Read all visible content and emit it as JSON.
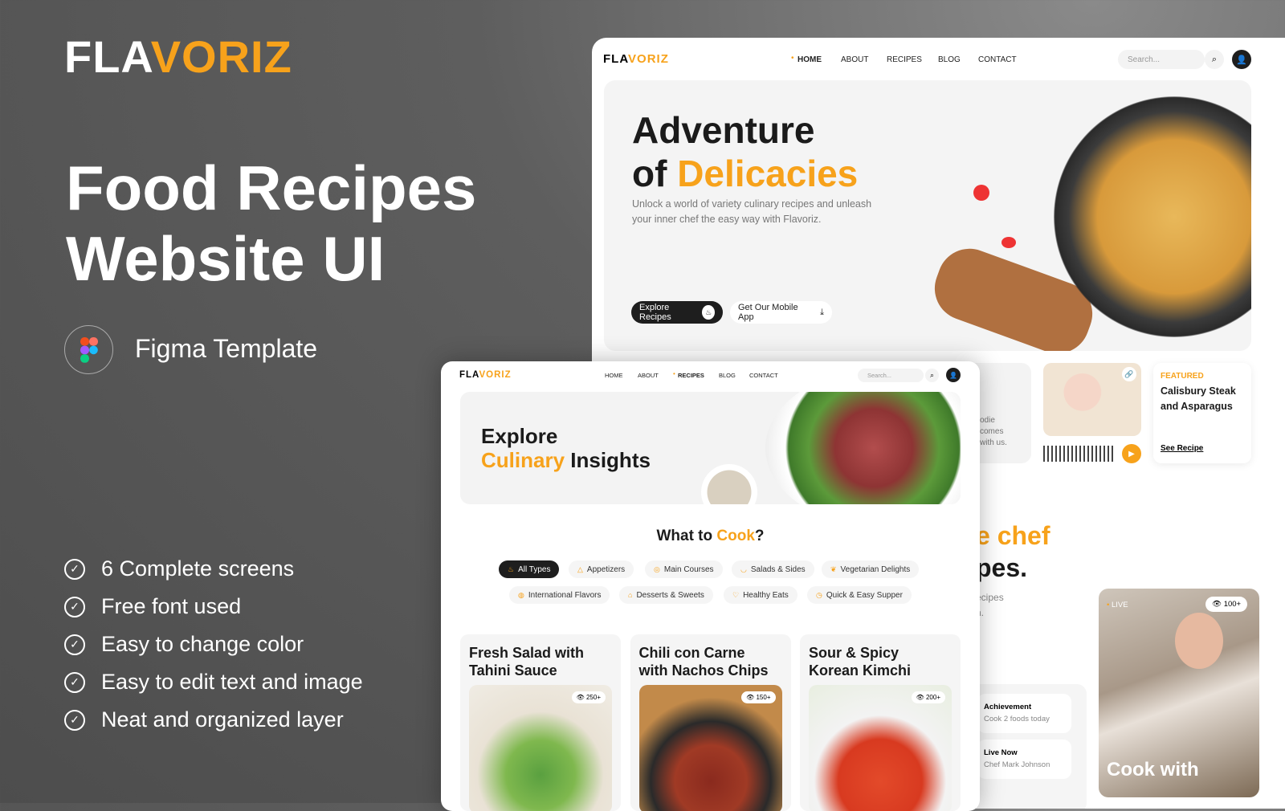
{
  "promo": {
    "logo_a": "FLA",
    "logo_b": "VORIZ",
    "title_l1": "Food Recipes",
    "title_l2": "Website UI",
    "figma_label": "Figma Template",
    "features": [
      "6 Complete screens",
      "Free font used",
      "Easy to change color",
      "Easy to edit text and image",
      "Neat and organized layer"
    ]
  },
  "colors": {
    "accent": "#f7a21b",
    "dark": "#1e1e1e"
  },
  "home_screen": {
    "logo_a": "FLA",
    "logo_b": "VORIZ",
    "nav": [
      "HOME",
      "ABOUT",
      "RECIPES",
      "BLOG",
      "CONTACT"
    ],
    "active_nav": "HOME",
    "search_placeholder": "Search...",
    "hero_title_l1": "Adventure",
    "hero_title_of": "of",
    "hero_title_accent": "Delicacies",
    "hero_sub": "Unlock a world of variety culinary recipes and unleash your inner chef the easy way with Flavoriz.",
    "btn_explore": "Explore Recipes",
    "btn_app": "Get Our Mobile App",
    "partial_text": [
      "odie",
      "comes",
      "with us."
    ],
    "featured": {
      "tag": "FEATURED",
      "title": "Calisbury Steak and Asparagus",
      "link": "See Recipe"
    },
    "section_accent": "e chef",
    "section_l2": "pes.",
    "section_sub": [
      "ecipes",
      "n."
    ],
    "achievement": {
      "title": "Achievement",
      "text": "Cook 2 foods today"
    },
    "live_now": {
      "title": "Live Now",
      "text": "Chef Mark Johnson"
    },
    "live_card": {
      "tag": "LIVE",
      "views": "100+",
      "caption": "Cook with"
    }
  },
  "recipes_screen": {
    "logo_a": "FLA",
    "logo_b": "VORIZ",
    "nav": [
      "HOME",
      "ABOUT",
      "RECIPES",
      "BLOG",
      "CONTACT"
    ],
    "active_nav": "RECIPES",
    "search_placeholder": "Search...",
    "banner_l1": "Explore",
    "banner_accent": "Culinary",
    "banner_rest": "Insights",
    "section_title": "What to ",
    "section_accent": "Cook",
    "section_q": "?",
    "chips": [
      "All Types",
      "Appetizers",
      "Main Courses",
      "Salads & Sides",
      "Vegetarian Delights",
      "International Flavors",
      "Desserts & Sweets",
      "Healthy Eats",
      "Quick & Easy Supper"
    ],
    "active_chip": "All Types",
    "cards": [
      {
        "title": "Fresh Salad with Tahini Sauce",
        "views": "250+"
      },
      {
        "title": "Chili con Carne with Nachos Chips",
        "views": "150+"
      },
      {
        "title": "Sour & Spicy Korean Kimchi",
        "views": "200+"
      }
    ]
  }
}
